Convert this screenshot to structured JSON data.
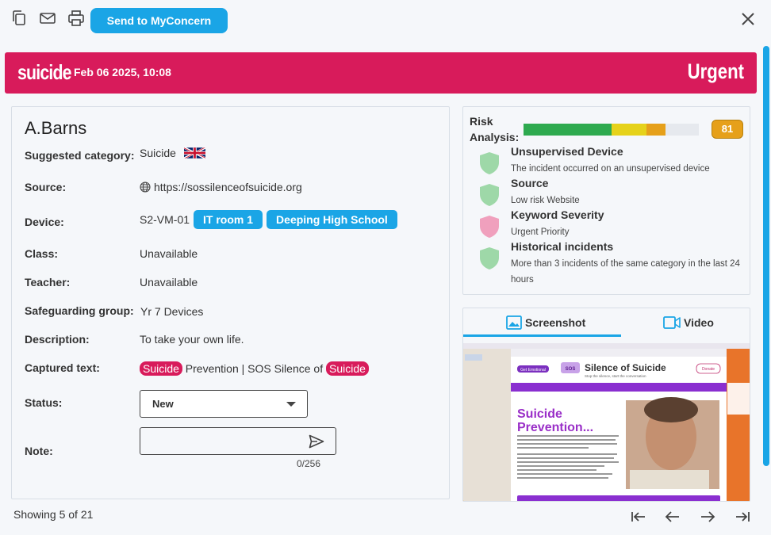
{
  "toolbar": {
    "copy_icon": "copy-icon",
    "mail_icon": "mail-icon",
    "print_icon": "print-icon",
    "send_label": "Send to MyConcern",
    "close_icon": "close-icon"
  },
  "banner": {
    "category": "suicide",
    "date": "Feb 06 2025, 10:08",
    "priority": "Urgent",
    "color": "#d81b5b"
  },
  "incident": {
    "name": "A.Barns",
    "fields": {
      "suggested_category": {
        "label": "Suggested category:",
        "value": "Suicide"
      },
      "source": {
        "label": "Source:",
        "value": "https://sossilenceofsuicide.org"
      },
      "device": {
        "label": "Device:",
        "value": "S2-VM-01",
        "tags": [
          "IT room 1",
          "Deeping High School"
        ]
      },
      "class": {
        "label": "Class:",
        "value": "Unavailable"
      },
      "teacher": {
        "label": "Teacher:",
        "value": "Unavailable"
      },
      "group": {
        "label": "Safeguarding group:",
        "value": "Yr 7 Devices"
      },
      "description": {
        "label": "Description:",
        "value": "To take your own life."
      },
      "captured": {
        "label": "Captured text:",
        "parts": [
          "Suicide",
          " Prevention | SOS Silence of ",
          "Suicide"
        ]
      },
      "status": {
        "label": "Status:",
        "value": "New"
      },
      "note": {
        "label": "Note:",
        "value": "",
        "counter": "0/256"
      }
    }
  },
  "risk": {
    "title_line1": "Risk",
    "title_line2": "Analysis:",
    "score": "81",
    "level_fraction": 0.81,
    "factors": [
      {
        "title": "Unsupervised Device",
        "desc": "The incident occurred on an unsupervised device",
        "status": "green"
      },
      {
        "title": "Source",
        "desc": "Low risk Website",
        "status": "green"
      },
      {
        "title": "Keyword Severity",
        "desc": "Urgent Priority",
        "status": "pink"
      },
      {
        "title": "Historical incidents",
        "desc": "More than 3 incidents of the same category in the last 24 hours",
        "status": "green"
      }
    ]
  },
  "media": {
    "tabs": [
      "Screenshot",
      "Video"
    ],
    "active_tab": "Screenshot",
    "screenshot": {
      "site_title": "Silence of Suicide",
      "site_sub": "Stop the silence, start the conversation",
      "heading1": "Suicide",
      "heading2": "Prevention...",
      "cta": "Get Emotional",
      "donate": "Donate",
      "logo": "SOS"
    }
  },
  "footer": {
    "showing": "Showing 5 of 21"
  }
}
